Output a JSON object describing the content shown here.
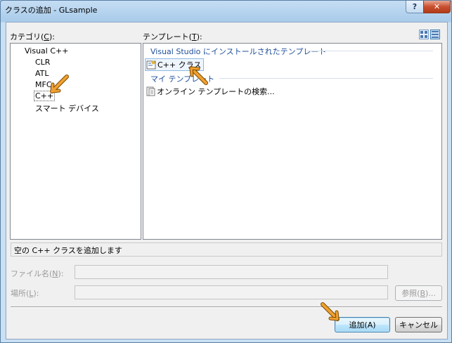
{
  "window": {
    "title": "クラスの追加 - GLsample",
    "help_label": "?",
    "close_label": "✕"
  },
  "categories": {
    "label_pre": "カテゴリ(",
    "label_key": "C",
    "label_post": "):",
    "items": [
      "Visual C++",
      "CLR",
      "ATL",
      "MFC",
      "C++",
      "スマート デバイス"
    ],
    "selected": "C++"
  },
  "templates": {
    "label_pre": "テンプレート(",
    "label_key": "T",
    "label_post": "):",
    "installed_group": "Visual Studio にインストールされたテンプレート",
    "installed_item": "C++ クラス",
    "my_group": "マイ テンプレート",
    "online_item": "オンライン テンプレートの検索...",
    "view_icons": [
      "large-icons-view-icon",
      "small-icons-view-icon"
    ]
  },
  "description": "空の C++ クラスを追加します",
  "form": {
    "name_label_pre": "ファイル名(",
    "name_key": "N",
    "name_label_post": "):",
    "name_value": "",
    "location_label_pre": "場所(",
    "location_key": "L",
    "location_label_post": "):",
    "location_value": "",
    "browse_label_pre": "参照(",
    "browse_key": "B",
    "browse_label_post": ")..."
  },
  "buttons": {
    "add": "追加(A)",
    "cancel": "キャンセル"
  },
  "colors": {
    "accent": "#1e4e9a",
    "arrow": "#f0a030"
  }
}
